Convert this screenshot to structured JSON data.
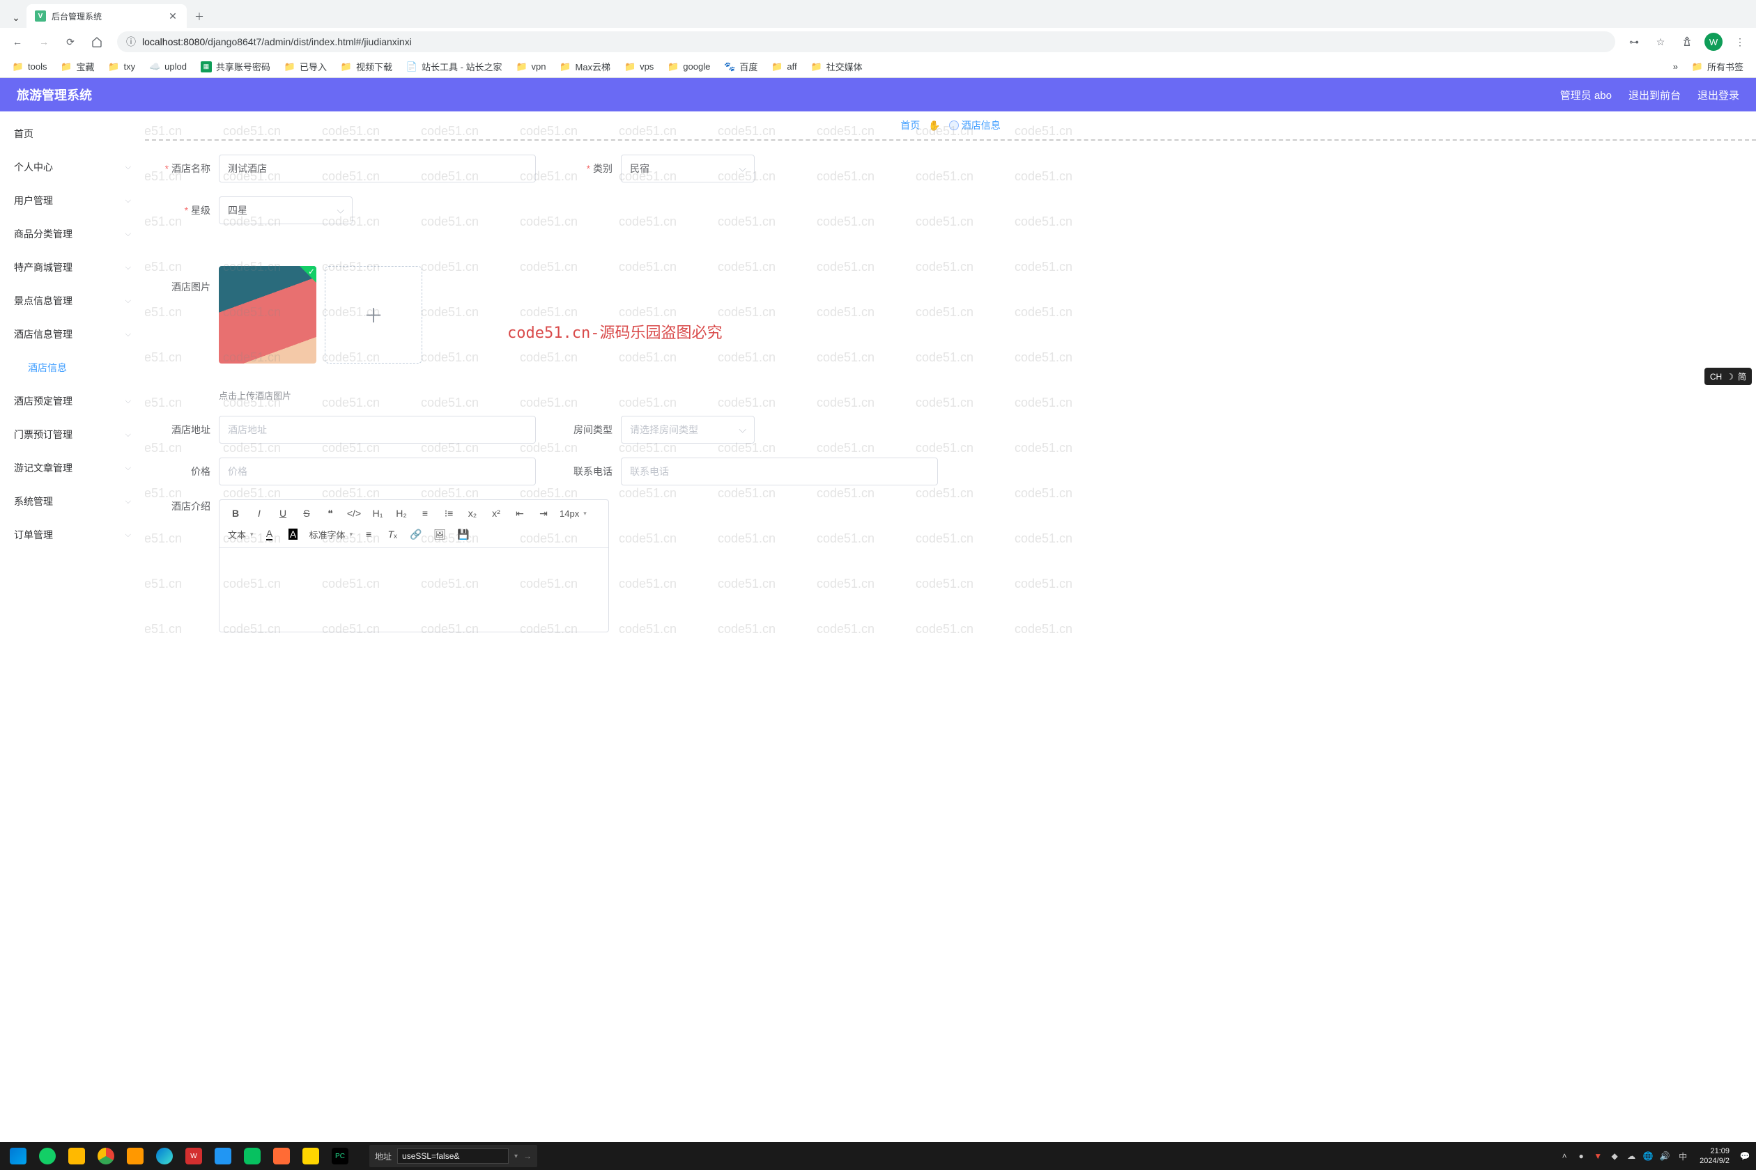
{
  "browser": {
    "tab_title": "后台管理系统",
    "url_host": "localhost:8080",
    "url_path": "/django864t7/admin/dist/index.html#/jiudianxinxi",
    "profile_letter": "W"
  },
  "bookmarks": [
    {
      "label": "tools",
      "icon": "folder"
    },
    {
      "label": "宝藏",
      "icon": "folder"
    },
    {
      "label": "txy",
      "icon": "folder"
    },
    {
      "label": "uplod",
      "icon": "cloud"
    },
    {
      "label": "共享账号密码",
      "icon": "sheet"
    },
    {
      "label": "已导入",
      "icon": "folder"
    },
    {
      "label": "视频下载",
      "icon": "folder"
    },
    {
      "label": "站长工具 - 站长之家",
      "icon": "page"
    },
    {
      "label": "vpn",
      "icon": "folder"
    },
    {
      "label": "Max云梯",
      "icon": "folder"
    },
    {
      "label": "vps",
      "icon": "folder"
    },
    {
      "label": "google",
      "icon": "folder"
    },
    {
      "label": "百度",
      "icon": "paw"
    },
    {
      "label": "aff",
      "icon": "folder"
    },
    {
      "label": "社交媒体",
      "icon": "folder"
    }
  ],
  "bookmarks_right": {
    "label": "所有书签"
  },
  "app": {
    "title": "旅游管理系统",
    "header_user": "管理员 abo",
    "header_logout_front": "退出到前台",
    "header_logout": "退出登录"
  },
  "sidebar": [
    {
      "label": "首页",
      "expandable": false
    },
    {
      "label": "个人中心",
      "expandable": true
    },
    {
      "label": "用户管理",
      "expandable": true
    },
    {
      "label": "商品分类管理",
      "expandable": true
    },
    {
      "label": "特产商城管理",
      "expandable": true
    },
    {
      "label": "景点信息管理",
      "expandable": true
    },
    {
      "label": "酒店信息管理",
      "expandable": true
    },
    {
      "label": "酒店信息",
      "expandable": false,
      "indent": true,
      "active": true
    },
    {
      "label": "酒店预定管理",
      "expandable": true
    },
    {
      "label": "门票预订管理",
      "expandable": true
    },
    {
      "label": "游记文章管理",
      "expandable": true
    },
    {
      "label": "系统管理",
      "expandable": true
    },
    {
      "label": "订单管理",
      "expandable": true
    }
  ],
  "breadcrumb": {
    "home": "首页",
    "current": "酒店信息"
  },
  "form": {
    "hotel_name_label": "酒店名称",
    "hotel_name_value": "测试酒店",
    "category_label": "类别",
    "category_value": "民宿",
    "star_label": "星级",
    "star_value": "四星",
    "image_label": "酒店图片",
    "upload_hint": "点击上传酒店图片",
    "address_label": "酒店地址",
    "address_placeholder": "酒店地址",
    "room_type_label": "房间类型",
    "room_type_placeholder": "请选择房间类型",
    "price_label": "价格",
    "price_placeholder": "价格",
    "phone_label": "联系电话",
    "phone_placeholder": "联系电话",
    "intro_label": "酒店介绍"
  },
  "editor": {
    "font_size": "14px",
    "style_select": "文本",
    "font_family": "标准字体"
  },
  "watermark": {
    "repeat": "code51.cn",
    "big": "code51.cn-源码乐园盗图必究"
  },
  "ime": {
    "lang": "CH",
    "mode": "简"
  },
  "taskbar": {
    "addr_label": "地址",
    "addr_value": "useSSL=false&",
    "lang": "中",
    "time": "21:09",
    "date": "2024/9/2"
  }
}
